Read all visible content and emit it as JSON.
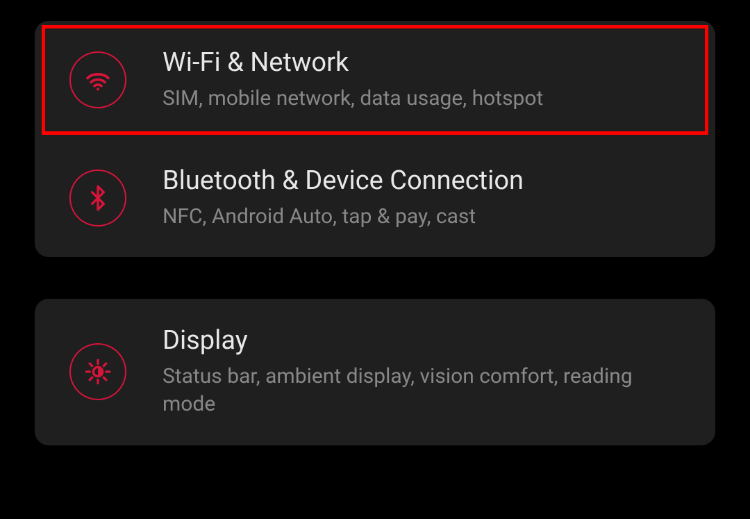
{
  "colors": {
    "accent": "#d7143a",
    "highlightBorder": "#ff0000",
    "cardBackground": "#1f1f1f",
    "pageBackground": "#000000"
  },
  "groups": [
    {
      "items": [
        {
          "icon": "wifi-icon",
          "title": "Wi-Fi & Network",
          "subtitle": "SIM, mobile network, data usage, hotspot",
          "highlighted": true
        },
        {
          "icon": "bluetooth-icon",
          "title": "Bluetooth & Device Connection",
          "subtitle": "NFC, Android Auto, tap & pay, cast",
          "highlighted": false
        }
      ]
    },
    {
      "items": [
        {
          "icon": "display-icon",
          "title": "Display",
          "subtitle": "Status bar, ambient display, vision comfort, reading mode",
          "highlighted": false
        }
      ]
    }
  ]
}
